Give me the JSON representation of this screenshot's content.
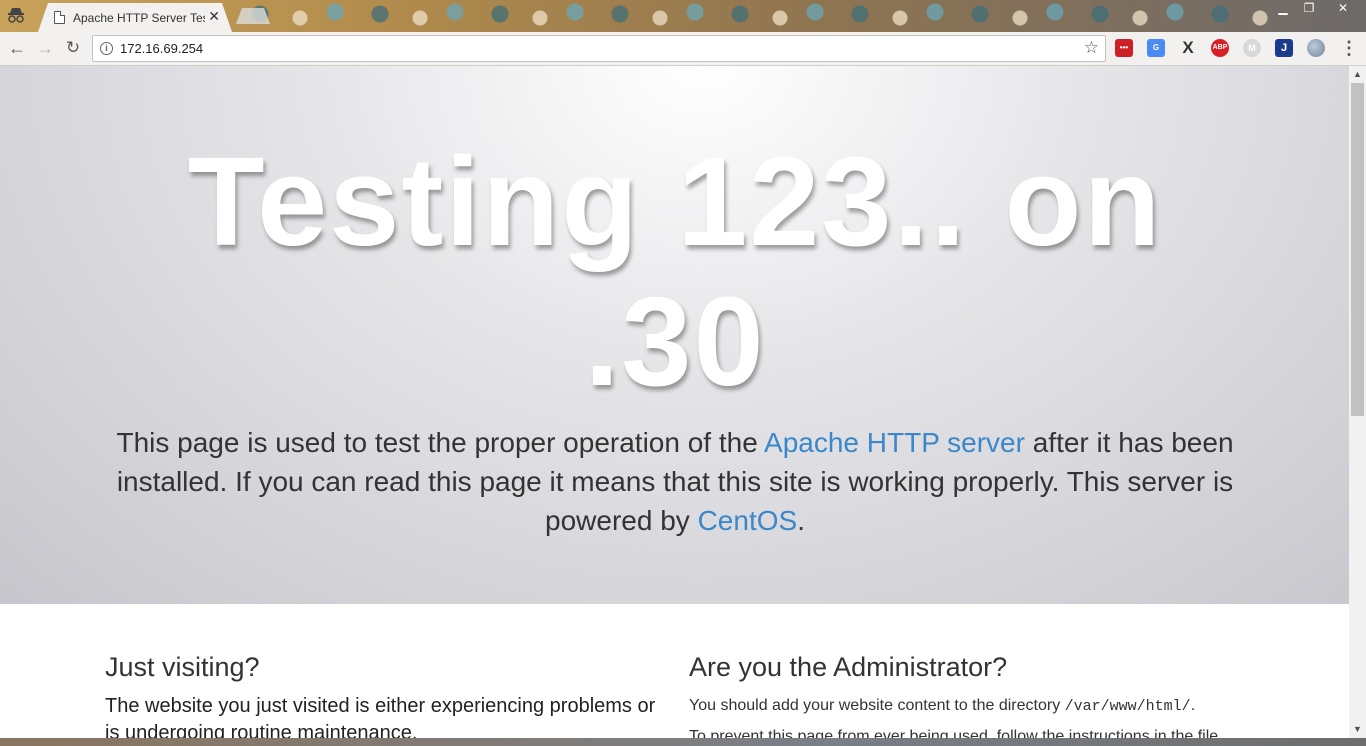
{
  "browser": {
    "tab": {
      "title": "Apache HTTP Server Test Page powered by CentOS",
      "close_glyph": "✕"
    },
    "window_controls": {
      "minimize": "▁",
      "maximize": "❐",
      "close": "✕"
    },
    "nav": {
      "back": "←",
      "forward": "→",
      "reload": "↻"
    },
    "address": {
      "url": "172.16.69.254",
      "info_glyph": "i",
      "star_glyph": "☆"
    },
    "extensions": {
      "lastpass": "•••",
      "translate": "G",
      "x": "X",
      "abp": "ABP",
      "m": "M",
      "j": "J",
      "globe": ""
    },
    "menu_glyph": "⋮"
  },
  "page": {
    "hero_title": "Testing 123.. on .30",
    "lead": {
      "text_1": "This page is used to test the proper operation of the ",
      "link_apache": "Apache HTTP server",
      "text_2": " after it has been installed. If you can read this page it means that this site is working properly. This server is powered by ",
      "link_centos": "CentOS",
      "text_3": "."
    },
    "left_column": {
      "heading": "Just visiting?",
      "body": "The website you just visited is either experiencing problems or is undergoing routine maintenance."
    },
    "right_column": {
      "heading": "Are you the Administrator?",
      "body_prefix": "You should add your website content to the directory ",
      "directory": "/var/www/html/",
      "body_suffix": ".",
      "body_2": "To prevent this page from ever being used, follow the instructions in the file"
    }
  },
  "scrollbar": {
    "up": "▲",
    "down": "▼"
  },
  "colors": {
    "link": "#3a87c9",
    "hero_text": "#ffffff",
    "body_text": "#333333"
  }
}
